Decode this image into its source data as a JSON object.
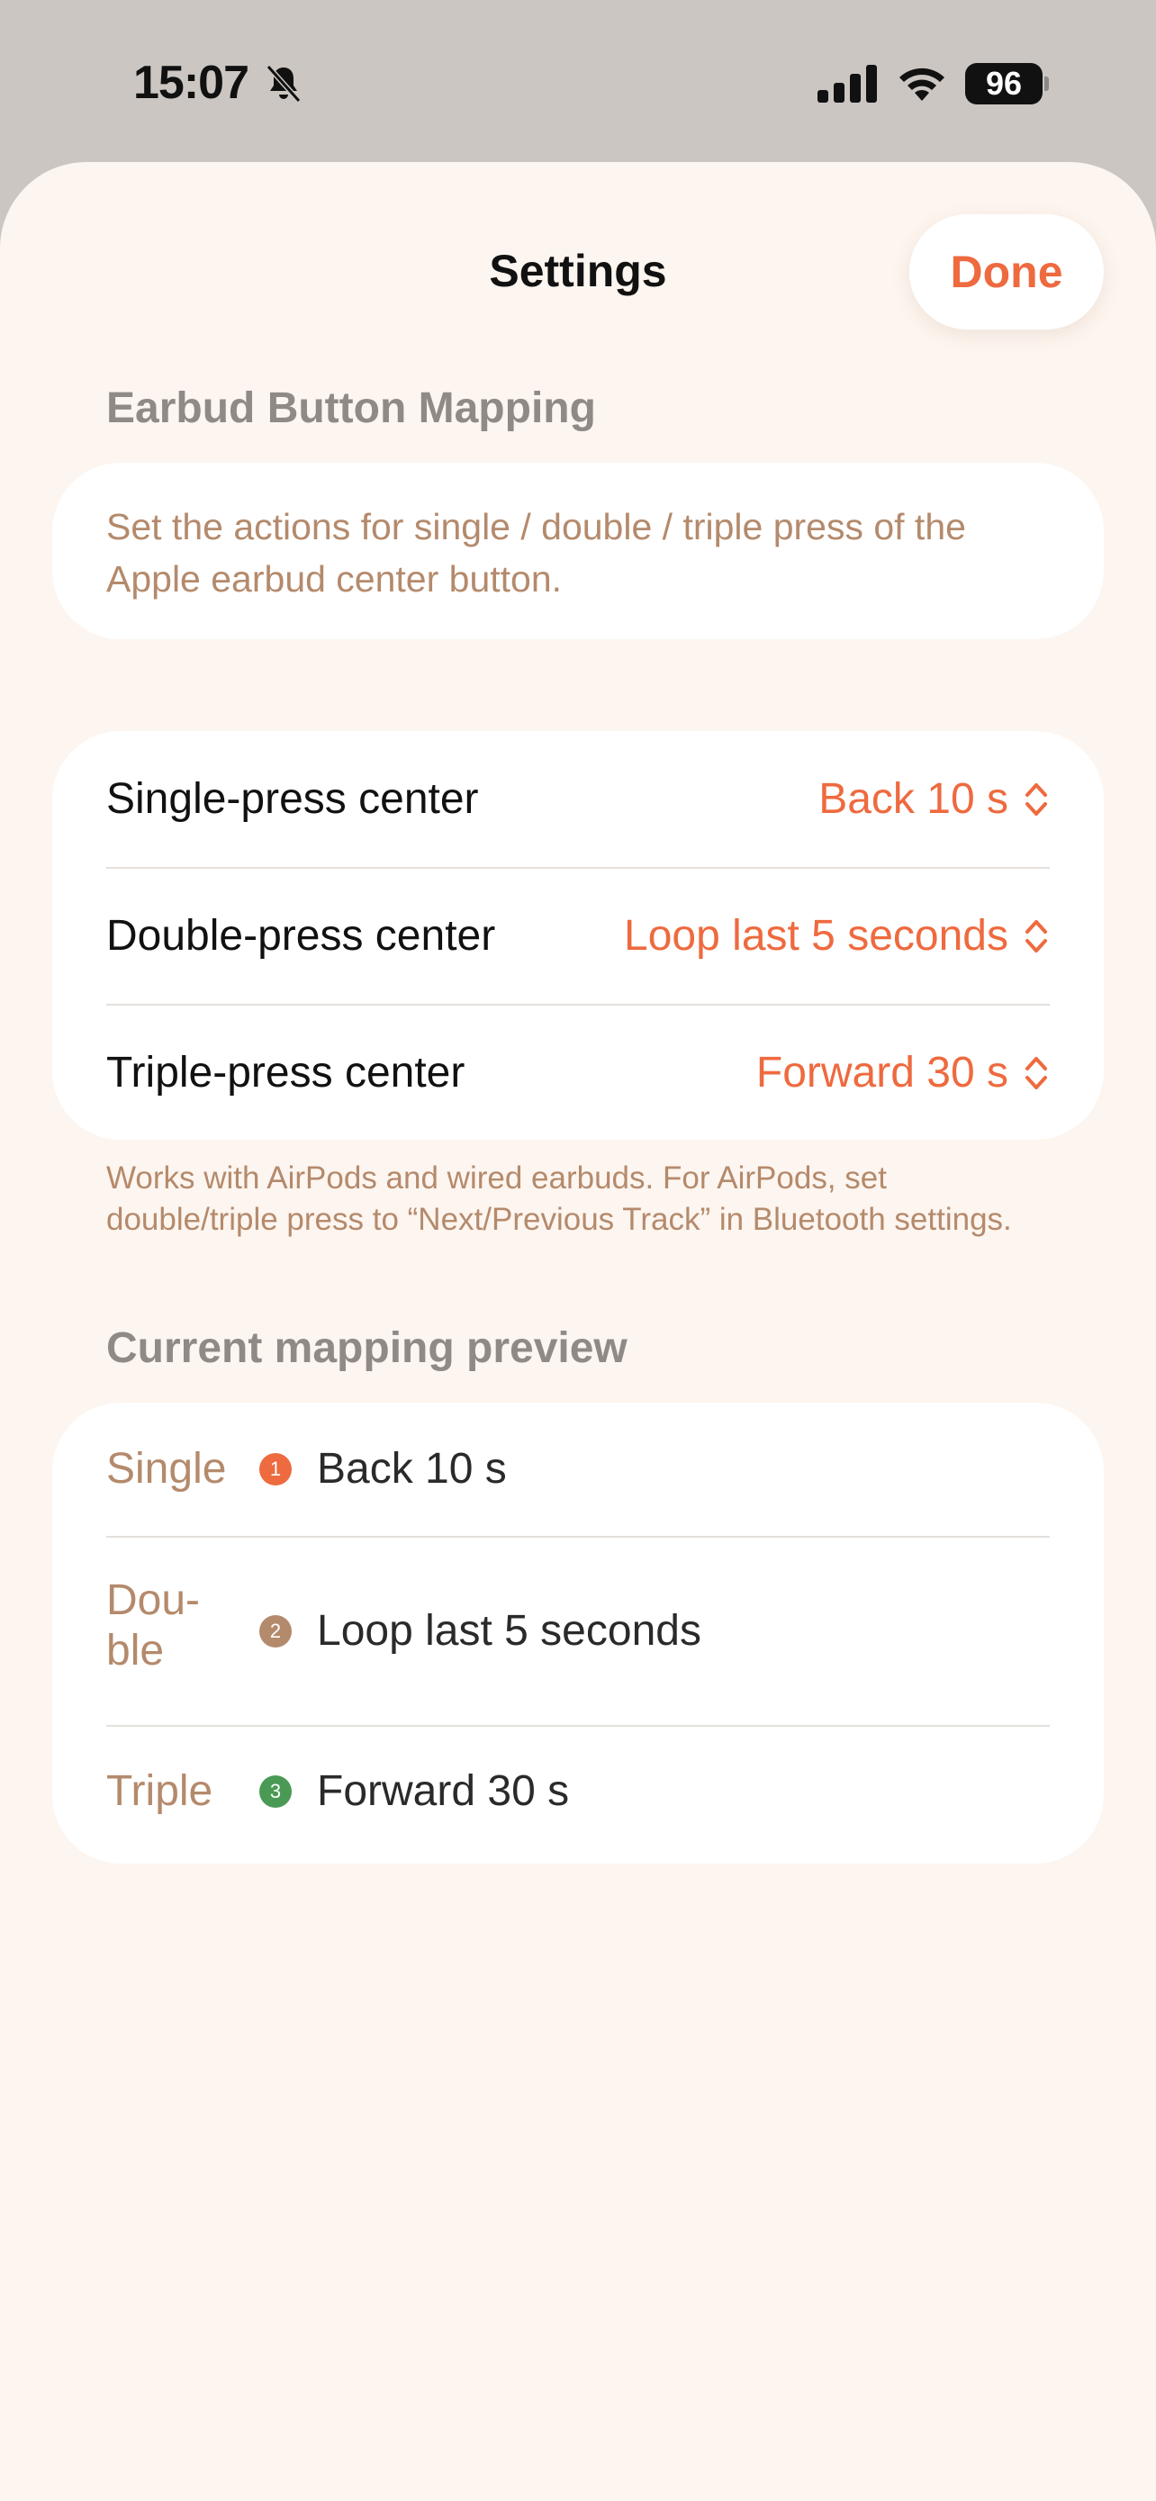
{
  "status_bar": {
    "time": "15:07",
    "battery": "96",
    "icons": [
      "bell-slash-icon",
      "signal-icon",
      "wifi-icon",
      "battery-icon"
    ]
  },
  "header": {
    "title": "Settings",
    "done_label": "Done"
  },
  "mapping_section": {
    "header": "Earbud Button Mapping",
    "description": "Set the actions for single / double / triple press of the Apple earbud center button.",
    "rows": [
      {
        "label": "Single-press center",
        "value": "Back 10 s"
      },
      {
        "label": "Double-press center",
        "value": "Loop last 5 seconds"
      },
      {
        "label": "Triple-press center",
        "value": "Forward 30 s"
      }
    ],
    "footnote": "Works with AirPods and wired earbuds. For AirPods, set double/triple press to “Next/Previous Track” in Bluetooth settings."
  },
  "preview_section": {
    "header": "Current mapping preview",
    "rows": [
      {
        "label": "Single",
        "badge": "1",
        "value": "Back 10 s",
        "badge_color": "#ee6a3f"
      },
      {
        "label": "Dou-\nble",
        "badge": "2",
        "value": "Loop last 5 seconds",
        "badge_color": "#b48a6c"
      },
      {
        "label": "Triple",
        "badge": "3",
        "value": "Forward 30 s",
        "badge_color": "#4a9a55"
      }
    ]
  },
  "colors": {
    "accent": "#ee6a3f",
    "muted_brown": "#b48a6c",
    "sheet_bg": "#fdf5ef"
  }
}
